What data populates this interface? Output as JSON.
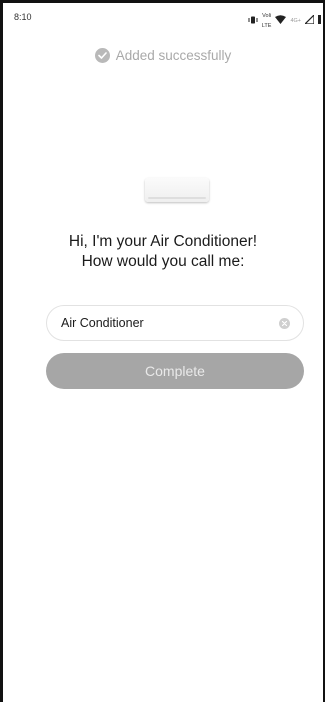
{
  "status_bar": {
    "time": "8:10",
    "volte_top": "Voli",
    "volte_bottom": "LTE",
    "network_label": "4G+",
    "icons": [
      "vibrate-icon",
      "volte-icon",
      "wifi-icon",
      "signal-icon",
      "battery-icon"
    ]
  },
  "toast": {
    "icon": "check-circle-icon",
    "text": "Added successfully"
  },
  "device": {
    "image": "air-conditioner-image"
  },
  "greeting": {
    "line1": "Hi, I'm your Air Conditioner!",
    "line2": "How would you call me:"
  },
  "name_field": {
    "value": "Air Conditioner",
    "clear_icon": "clear-icon"
  },
  "complete_button": {
    "label": "Complete",
    "color": "#a6a6a6"
  }
}
